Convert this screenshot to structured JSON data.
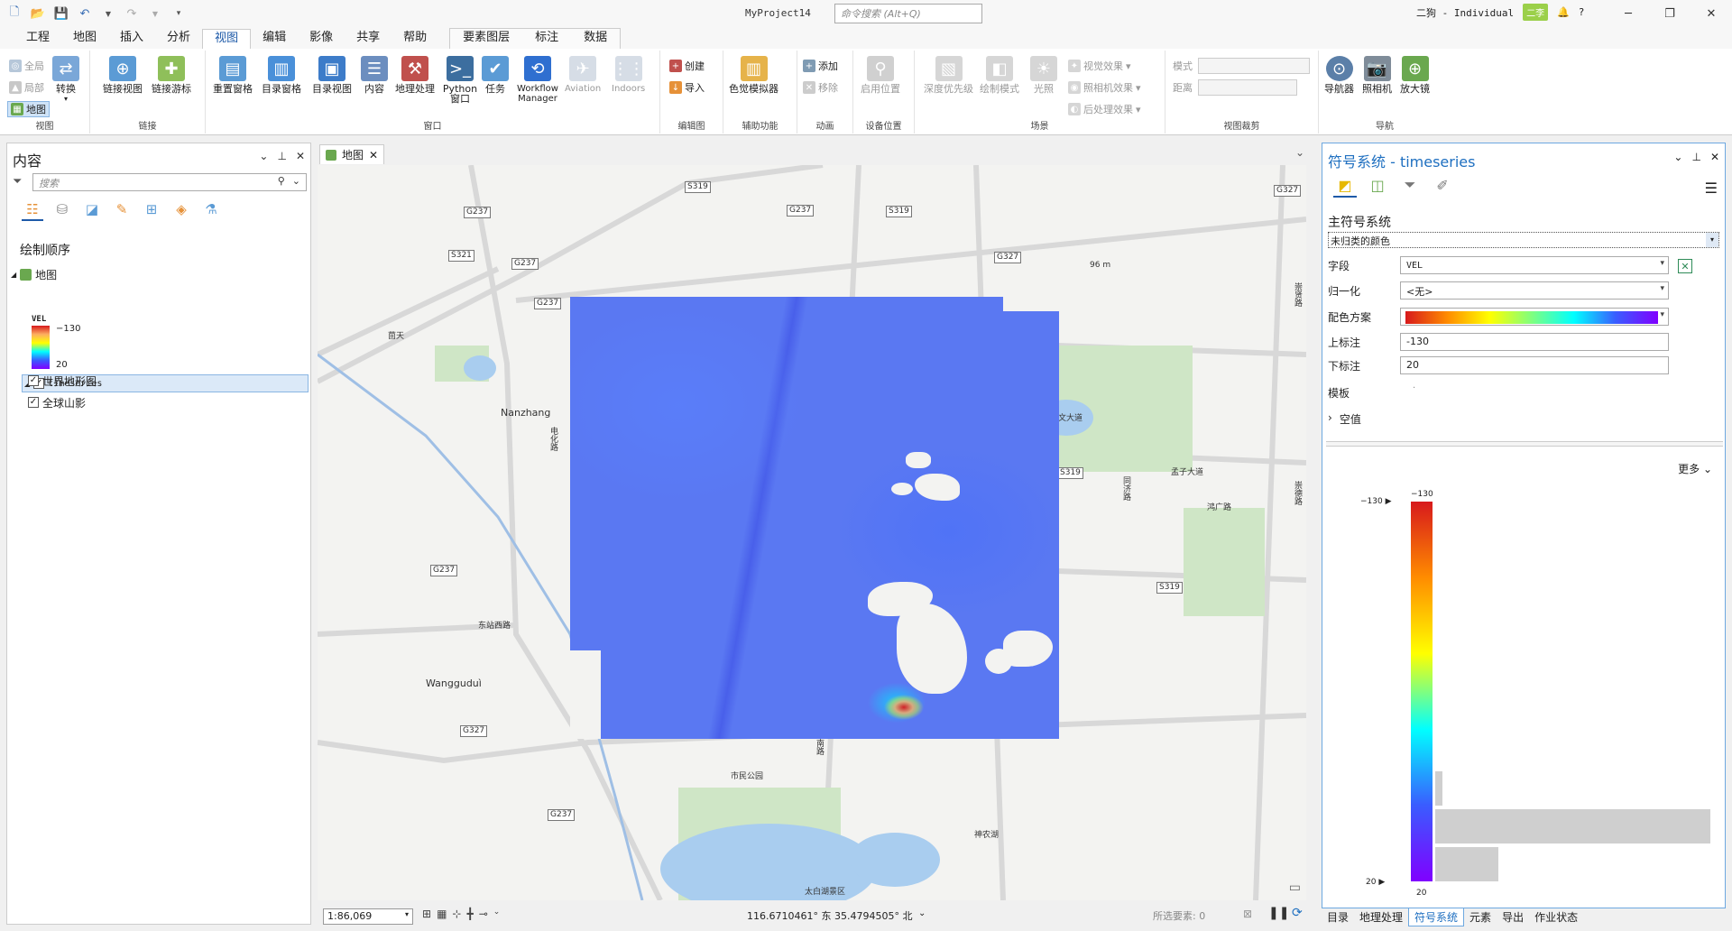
{
  "app": {
    "doc_title": "MyProject14",
    "command_search_placeholder": "命令搜索 (Alt+Q)",
    "user": "二狗 - Individual",
    "user_badge": "二李"
  },
  "ribbon_tabs": [
    "工程",
    "地图",
    "插入",
    "分析",
    "视图",
    "编辑",
    "影像",
    "共享",
    "帮助"
  ],
  "active_tab": "视图",
  "context_tabs": [
    "要素图层",
    "标注",
    "数据"
  ],
  "ribbon": {
    "view_group": {
      "label": "视图",
      "items": [
        "全局",
        "局部",
        "地图"
      ],
      "convert": "转换"
    },
    "link_group": {
      "label": "链接",
      "items": [
        "链接视图",
        "链接游标"
      ]
    },
    "window_group": {
      "label": "窗口",
      "items": [
        "重置窗格",
        "目录窗格",
        "目录视图",
        "内容",
        "地理处理",
        "Python 窗口",
        "任务",
        "Workflow Manager",
        "Aviation",
        "Indoors"
      ]
    },
    "compose_group": {
      "label": "编辑图",
      "items": [
        "创建",
        "导入"
      ]
    },
    "access_group": {
      "label": "辅助功能",
      "items": [
        "色觉模拟器"
      ]
    },
    "animation_group": {
      "label": "动画",
      "items": [
        "添加",
        "移除"
      ]
    },
    "device_group": {
      "label": "设备位置",
      "items": [
        "启用位置"
      ]
    },
    "scene_group": {
      "label": "场景",
      "items": [
        "深度优先级",
        "绘制模式",
        "光照",
        "视觉效果",
        "照相机效果",
        "后处理效果"
      ]
    },
    "clip_group": {
      "label": "视图裁剪",
      "mode": "模式",
      "distance": "距离"
    },
    "nav_group": {
      "label": "导航",
      "items": [
        "导航器",
        "照相机",
        "放大镜"
      ]
    }
  },
  "contents": {
    "title": "内容",
    "search_placeholder": "搜索",
    "draw_order": "绘制顺序",
    "map_name": "地图",
    "layers": [
      {
        "name": "timeseries",
        "checked": true,
        "selected": true
      },
      {
        "name": "世界地形图",
        "checked": true
      },
      {
        "name": "全球山影",
        "checked": true
      }
    ],
    "legend": {
      "field": "VEL",
      "high": "−130",
      "low": "20"
    }
  },
  "map": {
    "tab_label": "地图",
    "scale": "1:86,069",
    "coordinates": "116.6710461° 东 35.4794505° 北",
    "selected_features": "所选要素: 0",
    "roads": [
      "S319",
      "G237",
      "G237",
      "S319",
      "G327",
      "S321",
      "G237",
      "G237",
      "G327",
      "G237",
      "G327",
      "S319",
      "G237",
      "S319"
    ],
    "places": [
      "茴天",
      "Nanzhang",
      "电化路",
      "东站西路",
      "Wangguduì",
      "市民公园",
      "神农湖",
      "太白湖景区",
      "96 m",
      "崇文大道",
      "孟子大道",
      "鸿广路",
      "同济路",
      "崇德路",
      "崇贤路",
      "南路"
    ]
  },
  "symbology": {
    "title": "符号系统 - timeseries",
    "primary_label": "主符号系统",
    "primary_value": "未归类的颜色",
    "fields": [
      {
        "label": "字段",
        "value": "VEL"
      },
      {
        "label": "归一化",
        "value": "<无>"
      },
      {
        "label": "配色方案",
        "value": ""
      },
      {
        "label": "上标注",
        "value": "-130"
      },
      {
        "label": "下标注",
        "value": "20"
      },
      {
        "label": "模板",
        "value": "·"
      }
    ],
    "nodata_label": "空值",
    "more_label": "更多",
    "histogram": {
      "top_label": "−130",
      "top_marker": "−130 ▶",
      "bottom_label": "20",
      "bottom_marker": "20 ▶"
    }
  },
  "bottom_tabs": [
    "目录",
    "地理处理",
    "符号系统",
    "元素",
    "导出",
    "作业状态"
  ],
  "active_bottom_tab": "符号系统"
}
